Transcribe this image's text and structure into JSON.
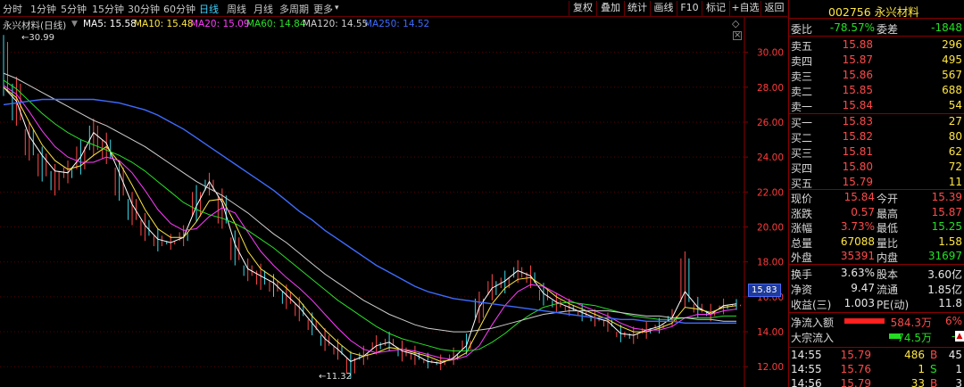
{
  "tabs": [
    "分时",
    "1分钟",
    "5分钟",
    "15分钟",
    "30分钟",
    "60分钟",
    "日线",
    "周线",
    "月线",
    "多周期",
    "更多"
  ],
  "active_tab": "日线",
  "tab_more_arrow": "▾",
  "toolbar": [
    "复权",
    "叠加",
    "统计",
    "画线",
    "F10",
    "标记",
    "+自选",
    "返回"
  ],
  "chart": {
    "title": "永兴材料(日线)",
    "ma": [
      {
        "label": "MA5: 15.58",
        "color": "#ffffff"
      },
      {
        "label": "MA10: 15.48",
        "color": "#ffe640"
      },
      {
        "label": "MA20: 15.09",
        "color": "#ff3cff"
      },
      {
        "label": "MA60: 14.84",
        "color": "#28e028"
      },
      {
        "label": "MA120: 14.55",
        "color": "#cfcfcf"
      },
      {
        "label": "MA250: 14.52",
        "color": "#3d6bff"
      }
    ],
    "y_axis": [
      "30.00",
      "28.00",
      "26.00",
      "24.00",
      "22.00",
      "20.00",
      "18.00",
      "16.00",
      "14.00",
      "12.00"
    ],
    "current_price": "15.83",
    "high_label": "30.99",
    "low_label": "11.32",
    "high_arrow": "←",
    "low_arrow": "←"
  },
  "chart_data": {
    "type": "candlestick-line",
    "ylim": [
      11.4,
      31
    ],
    "y_ticks": [
      30,
      28,
      26,
      24,
      22,
      20,
      18,
      16,
      14,
      12
    ],
    "series": [
      {
        "name": "MA5",
        "color": "#ffffff",
        "values": [
          28.0,
          27.2,
          25.2,
          24.1,
          23.2,
          23.1,
          24.0,
          25.4,
          24.8,
          23.1,
          21.3,
          20.1,
          19.3,
          19.1,
          19.4,
          21.2,
          22.6,
          21.4,
          19.0,
          17.6,
          17.2,
          16.8,
          16.1,
          15.4,
          14.5,
          13.6,
          13.0,
          12.3,
          12.6,
          13.2,
          13.4,
          12.9,
          12.7,
          12.3,
          12.2,
          12.5,
          13.2,
          15.4,
          16.5,
          16.9,
          17.5,
          17.2,
          16.2,
          15.7,
          15.4,
          15.1,
          14.8,
          14.6,
          13.9,
          13.8,
          14.1,
          14.3,
          14.8,
          16.3,
          15.4,
          15.0,
          15.5,
          15.6
        ]
      },
      {
        "name": "MA10",
        "color": "#ffe640",
        "values": [
          28.0,
          27.4,
          26.0,
          24.7,
          23.8,
          23.3,
          23.5,
          24.1,
          24.6,
          23.7,
          22.4,
          21.0,
          19.9,
          19.4,
          19.4,
          20.3,
          21.5,
          21.6,
          20.2,
          18.6,
          17.6,
          17.1,
          16.5,
          15.8,
          14.9,
          14.1,
          13.4,
          12.8,
          12.6,
          12.8,
          13.1,
          13.0,
          12.8,
          12.6,
          12.3,
          12.4,
          12.8,
          14.2,
          15.6,
          16.5,
          17.0,
          17.1,
          16.6,
          16.0,
          15.6,
          15.3,
          15.0,
          14.7,
          14.3,
          14.0,
          14.0,
          14.2,
          14.5,
          15.4,
          15.3,
          15.1,
          15.4,
          15.5
        ]
      },
      {
        "name": "MA20",
        "color": "#ff3cff",
        "values": [
          28.1,
          27.6,
          26.6,
          25.5,
          24.6,
          24.0,
          23.7,
          23.7,
          24.0,
          23.8,
          23.1,
          22.1,
          21.0,
          20.2,
          19.8,
          19.9,
          20.6,
          21.1,
          20.8,
          19.7,
          18.6,
          17.8,
          17.1,
          16.5,
          15.8,
          15.0,
          14.2,
          13.5,
          13.0,
          12.8,
          12.9,
          13.0,
          12.9,
          12.7,
          12.5,
          12.4,
          12.6,
          13.2,
          14.4,
          15.5,
          16.3,
          16.7,
          16.6,
          16.2,
          15.8,
          15.5,
          15.2,
          14.9,
          14.5,
          14.2,
          14.1,
          14.1,
          14.3,
          14.8,
          15.0,
          15.0,
          15.2,
          15.3
        ]
      },
      {
        "name": "MA60",
        "color": "#28e028",
        "values": [
          28.4,
          27.9,
          27.2,
          26.5,
          25.9,
          25.4,
          25.0,
          24.7,
          24.4,
          24.1,
          23.7,
          23.2,
          22.6,
          22.0,
          21.4,
          21.0,
          20.7,
          20.5,
          20.2,
          19.8,
          19.3,
          18.8,
          18.2,
          17.6,
          17.0,
          16.4,
          15.8,
          15.3,
          14.8,
          14.3,
          13.9,
          13.6,
          13.4,
          13.2,
          13.0,
          12.9,
          12.9,
          13.0,
          13.4,
          13.9,
          14.5,
          15.0,
          15.4,
          15.6,
          15.7,
          15.6,
          15.5,
          15.3,
          15.1,
          14.9,
          14.8,
          14.7,
          14.7,
          14.8,
          14.8,
          14.8,
          14.9,
          14.9
        ]
      },
      {
        "name": "MA120",
        "color": "#cfcfcf",
        "values": [
          28.8,
          28.5,
          28.1,
          27.7,
          27.3,
          26.9,
          26.5,
          26.1,
          25.8,
          25.4,
          25.0,
          24.6,
          24.1,
          23.6,
          23.1,
          22.6,
          22.2,
          21.8,
          21.3,
          20.8,
          20.2,
          19.6,
          19.1,
          18.5,
          17.9,
          17.3,
          16.8,
          16.3,
          15.8,
          15.4,
          15.0,
          14.7,
          14.4,
          14.2,
          14.1,
          14.0,
          14.0,
          14.1,
          14.2,
          14.4,
          14.6,
          14.8,
          15.0,
          15.1,
          15.2,
          15.2,
          15.2,
          15.2,
          15.1,
          15.0,
          14.9,
          14.9,
          14.8,
          14.8,
          14.7,
          14.7,
          14.6,
          14.6
        ]
      },
      {
        "name": "MA250",
        "color": "#3d6bff",
        "values": [
          27.0,
          27.1,
          27.2,
          27.3,
          27.3,
          27.3,
          27.3,
          27.3,
          27.2,
          27.1,
          26.9,
          26.7,
          26.4,
          26.0,
          25.6,
          25.1,
          24.6,
          24.1,
          23.6,
          23.1,
          22.6,
          22.1,
          21.5,
          20.9,
          20.4,
          19.8,
          19.3,
          18.8,
          18.3,
          17.8,
          17.4,
          17.0,
          16.6,
          16.3,
          16.1,
          15.9,
          15.8,
          15.7,
          15.6,
          15.5,
          15.4,
          15.3,
          15.2,
          15.1,
          15.0,
          14.9,
          14.8,
          14.8,
          14.7,
          14.7,
          14.6,
          14.6,
          14.6,
          14.5,
          14.5,
          14.5,
          14.5,
          14.5
        ]
      }
    ],
    "candles": [
      {
        "high": 30.99,
        "low": 27.5
      },
      {
        "high": 28.6,
        "low": 25.8
      },
      {
        "high": 26.0,
        "low": 23.8
      },
      {
        "high": 24.6,
        "low": 22.6
      },
      {
        "high": 23.6,
        "low": 21.8
      },
      {
        "high": 23.8,
        "low": 22.5
      },
      {
        "high": 25.0,
        "low": 23.0
      },
      {
        "high": 26.2,
        "low": 24.1
      },
      {
        "high": 25.4,
        "low": 23.6
      },
      {
        "high": 23.8,
        "low": 21.5
      },
      {
        "high": 22.0,
        "low": 20.1
      },
      {
        "high": 20.8,
        "low": 19.2
      },
      {
        "high": 19.9,
        "low": 18.6
      },
      {
        "high": 19.6,
        "low": 18.7
      },
      {
        "high": 20.1,
        "low": 18.9
      },
      {
        "high": 22.4,
        "low": 20.3
      },
      {
        "high": 23.1,
        "low": 21.8
      },
      {
        "high": 22.2,
        "low": 19.9
      },
      {
        "high": 19.8,
        "low": 17.8
      },
      {
        "high": 18.2,
        "low": 16.9
      },
      {
        "high": 17.9,
        "low": 16.4
      },
      {
        "high": 17.3,
        "low": 16.0
      },
      {
        "high": 16.7,
        "low": 15.3
      },
      {
        "high": 16.0,
        "low": 14.6
      },
      {
        "high": 15.1,
        "low": 13.8
      },
      {
        "high": 14.2,
        "low": 12.9
      },
      {
        "high": 13.6,
        "low": 12.4
      },
      {
        "high": 12.9,
        "low": 11.32
      },
      {
        "high": 13.2,
        "low": 12.1
      },
      {
        "high": 13.8,
        "low": 12.7
      },
      {
        "high": 14.0,
        "low": 12.9
      },
      {
        "high": 13.5,
        "low": 12.3
      },
      {
        "high": 13.2,
        "low": 12.1
      },
      {
        "high": 12.8,
        "low": 11.9
      },
      {
        "high": 12.7,
        "low": 11.8
      },
      {
        "high": 13.1,
        "low": 12.1
      },
      {
        "high": 13.9,
        "low": 12.7
      },
      {
        "high": 16.3,
        "low": 14.5
      },
      {
        "high": 17.3,
        "low": 15.8
      },
      {
        "high": 17.5,
        "low": 16.2
      },
      {
        "high": 18.1,
        "low": 16.8
      },
      {
        "high": 17.8,
        "low": 16.5
      },
      {
        "high": 16.8,
        "low": 15.5
      },
      {
        "high": 16.2,
        "low": 15.1
      },
      {
        "high": 15.9,
        "low": 14.9
      },
      {
        "high": 15.6,
        "low": 14.6
      },
      {
        "high": 15.3,
        "low": 14.3
      },
      {
        "high": 15.1,
        "low": 14.0
      },
      {
        "high": 14.4,
        "low": 13.4
      },
      {
        "high": 14.3,
        "low": 13.3
      },
      {
        "high": 14.6,
        "low": 13.6
      },
      {
        "high": 14.8,
        "low": 13.9
      },
      {
        "high": 15.3,
        "low": 14.3
      },
      {
        "high": 18.6,
        "low": 15.4
      },
      {
        "high": 16.0,
        "low": 14.8
      },
      {
        "high": 15.6,
        "low": 14.6
      },
      {
        "high": 15.9,
        "low": 15.0
      },
      {
        "high": 15.87,
        "low": 15.25
      }
    ]
  },
  "quote": {
    "code": "002756",
    "name": "永兴材料",
    "weibi_label": "委比",
    "weibi": "-78.57%",
    "weicha_label": "委差",
    "weicha": "-1848",
    "asks": [
      {
        "label": "卖五",
        "price": "15.88",
        "vol": "296"
      },
      {
        "label": "卖四",
        "price": "15.87",
        "vol": "495"
      },
      {
        "label": "卖三",
        "price": "15.86",
        "vol": "567"
      },
      {
        "label": "卖二",
        "price": "15.85",
        "vol": "688"
      },
      {
        "label": "卖一",
        "price": "15.84",
        "vol": "54"
      }
    ],
    "bids": [
      {
        "label": "买一",
        "price": "15.83",
        "vol": "27"
      },
      {
        "label": "买二",
        "price": "15.82",
        "vol": "80"
      },
      {
        "label": "买三",
        "price": "15.81",
        "vol": "62"
      },
      {
        "label": "买四",
        "price": "15.80",
        "vol": "72"
      },
      {
        "label": "买五",
        "price": "15.79",
        "vol": "11"
      }
    ],
    "stats": [
      {
        "l1": "现价",
        "v1": "15.84",
        "c1": "red",
        "l2": "今开",
        "v2": "15.39",
        "c2": "red"
      },
      {
        "l1": "涨跌",
        "v1": "0.57",
        "c1": "red",
        "l2": "最高",
        "v2": "15.87",
        "c2": "red"
      },
      {
        "l1": "涨幅",
        "v1": "3.73%",
        "c1": "red",
        "l2": "最低",
        "v2": "15.25",
        "c2": "grn"
      },
      {
        "l1": "总量",
        "v1": "67088",
        "c1": "yel",
        "l2": "量比",
        "v2": "1.58",
        "c2": "yel"
      },
      {
        "l1": "外盘",
        "v1": "35391",
        "c1": "red",
        "l2": "内盘",
        "v2": "31697",
        "c2": "grn"
      }
    ],
    "stats2": [
      {
        "l1": "换手",
        "v1": "3.63%",
        "l2": "股本",
        "v2": "3.60亿"
      },
      {
        "l1": "净资",
        "v1": "9.47",
        "l2": "流通",
        "v2": "1.85亿"
      },
      {
        "l1": "收益(三)",
        "v1": "1.003",
        "l2": "PE(动)",
        "v2": "11.8"
      }
    ],
    "flow": [
      {
        "label": "净流入额",
        "value": "584.3万",
        "pct": "6%",
        "bar": 0.75,
        "vcolor": "red"
      },
      {
        "label": "大宗流入",
        "value": "-74.5万",
        "pct": "-1",
        "bar": 0.22,
        "vcolor": "grn"
      }
    ],
    "flow_marker": "▲",
    "ticks": [
      {
        "time": "14:55",
        "price": "15.79",
        "vol": "486",
        "side": "B",
        "n": "45"
      },
      {
        "time": "14:55",
        "price": "15.76",
        "vol": "1",
        "side": "S",
        "n": "1"
      },
      {
        "time": "14:56",
        "price": "15.79",
        "vol": "33",
        "side": "B",
        "n": "3"
      }
    ]
  }
}
